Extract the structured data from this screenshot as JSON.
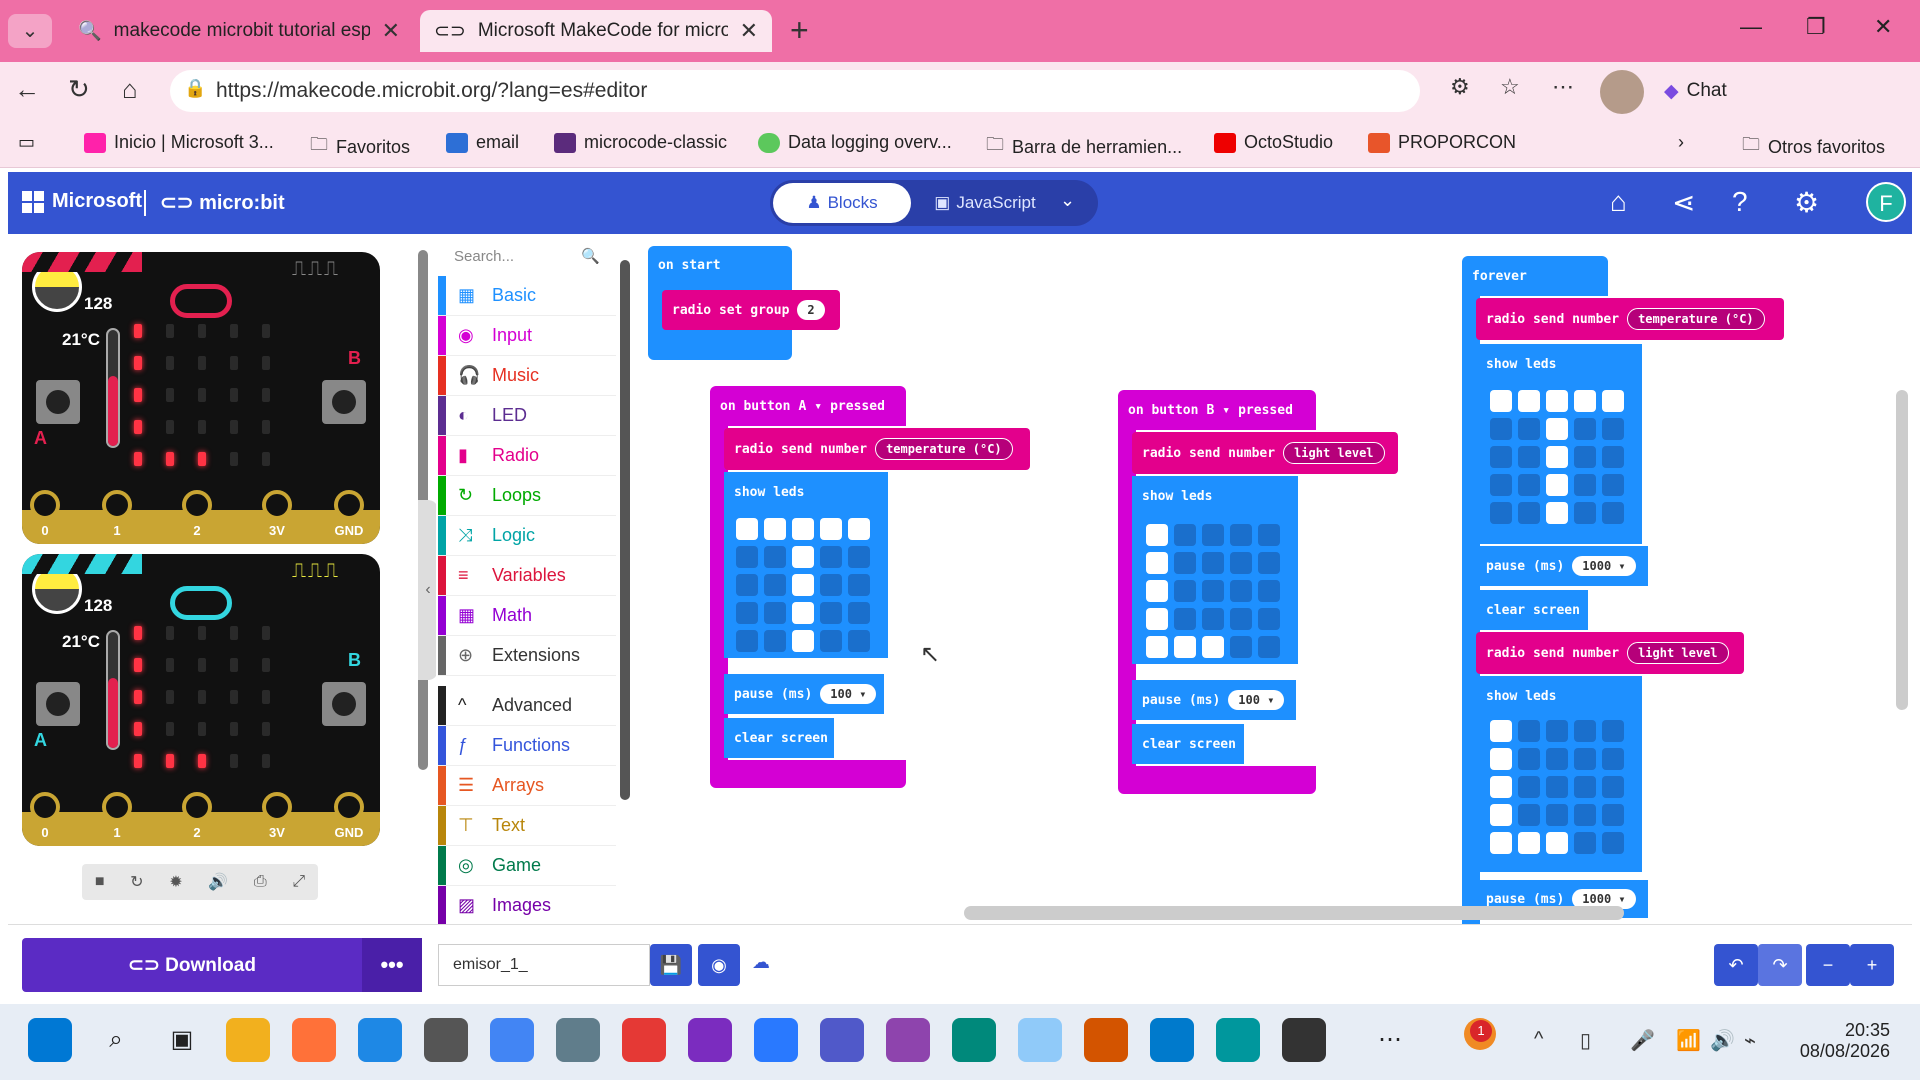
{
  "browser": {
    "tabs": [
      {
        "title": "makecode microbit tutorial españo",
        "close": "✕"
      },
      {
        "title": "Microsoft MakeCode for micro",
        "close": "✕"
      }
    ],
    "new_tab": "+",
    "url": "https://makecode.microbit.org/?lang=es#editor",
    "chat_label": "Chat",
    "bookmarks": [
      "Inicio | Microsoft 3...",
      "Favoritos",
      "email",
      "microcode-classic",
      "Data logging overv...",
      "Barra de herramien...",
      "OctoStudio",
      "PROPORCON",
      "Otros favoritos"
    ]
  },
  "header": {
    "ms_label": "Microsoft",
    "microbit_label": "micro:bit",
    "blocks_label": "Blocks",
    "js_label": "JavaScript",
    "avatar_letter": "F"
  },
  "simulator": {
    "boards": [
      {
        "level": "128",
        "temp": "21°C",
        "accent": "#e3204f",
        "pins": [
          "0",
          "1",
          "2",
          "3V",
          "GND"
        ],
        "btn_a": "A",
        "btn_b": "B"
      },
      {
        "level": "128",
        "temp": "21°C",
        "accent": "#33d6e0",
        "pins": [
          "0",
          "1",
          "2",
          "3V",
          "GND"
        ],
        "btn_a": "A",
        "btn_b": "B"
      }
    ]
  },
  "toolbox": {
    "search_placeholder": "Search...",
    "categories": [
      {
        "label": "Basic",
        "color": "#1e90ff",
        "icon": "▦"
      },
      {
        "label": "Input",
        "color": "#d400d4",
        "icon": "◉"
      },
      {
        "label": "Music",
        "color": "#e63022",
        "icon": "🎧"
      },
      {
        "label": "LED",
        "color": "#5c2d91",
        "icon": "◐"
      },
      {
        "label": "Radio",
        "color": "#e3008c",
        "icon": "▮"
      },
      {
        "label": "Loops",
        "color": "#00aa00",
        "icon": "↻"
      },
      {
        "label": "Logic",
        "color": "#00a4a6",
        "icon": "⤨"
      },
      {
        "label": "Variables",
        "color": "#dc143c",
        "icon": "≡"
      },
      {
        "label": "Math",
        "color": "#9400d3",
        "icon": "▦"
      },
      {
        "label": "Extensions",
        "color": "#666666",
        "icon": "⊕"
      },
      {
        "label": "Advanced",
        "color": "#222222",
        "icon": "^"
      },
      {
        "label": "Functions",
        "color": "#3455db",
        "icon": "ƒ"
      },
      {
        "label": "Arrays",
        "color": "#e65722",
        "icon": "☰"
      },
      {
        "label": "Text",
        "color": "#b8860b",
        "icon": "⊤"
      },
      {
        "label": "Game",
        "color": "#007a4b",
        "icon": "◎"
      },
      {
        "label": "Images",
        "color": "#7600a8",
        "icon": "▨"
      }
    ]
  },
  "blocks": {
    "on_start": "on start",
    "radio_set_group": "radio set group",
    "group_value": "2",
    "on_button_a": "on button",
    "btn_a": "A",
    "pressed": "pressed",
    "on_button_b": "on button",
    "btn_b": "B",
    "radio_send_number": "radio send number",
    "temperature": "temperature (°C)",
    "light_level": "light level",
    "show_leds": "show leds",
    "pause_ms": "pause (ms)",
    "pause_100": "100",
    "pause_1000": "1000",
    "clear_screen": "clear screen",
    "forever": "forever"
  },
  "footer": {
    "download": "Download",
    "more": "•••",
    "project_name": "emisor_1_"
  },
  "taskbar": {
    "time": "20:35",
    "date": "08/08/2026",
    "badge": "1"
  }
}
